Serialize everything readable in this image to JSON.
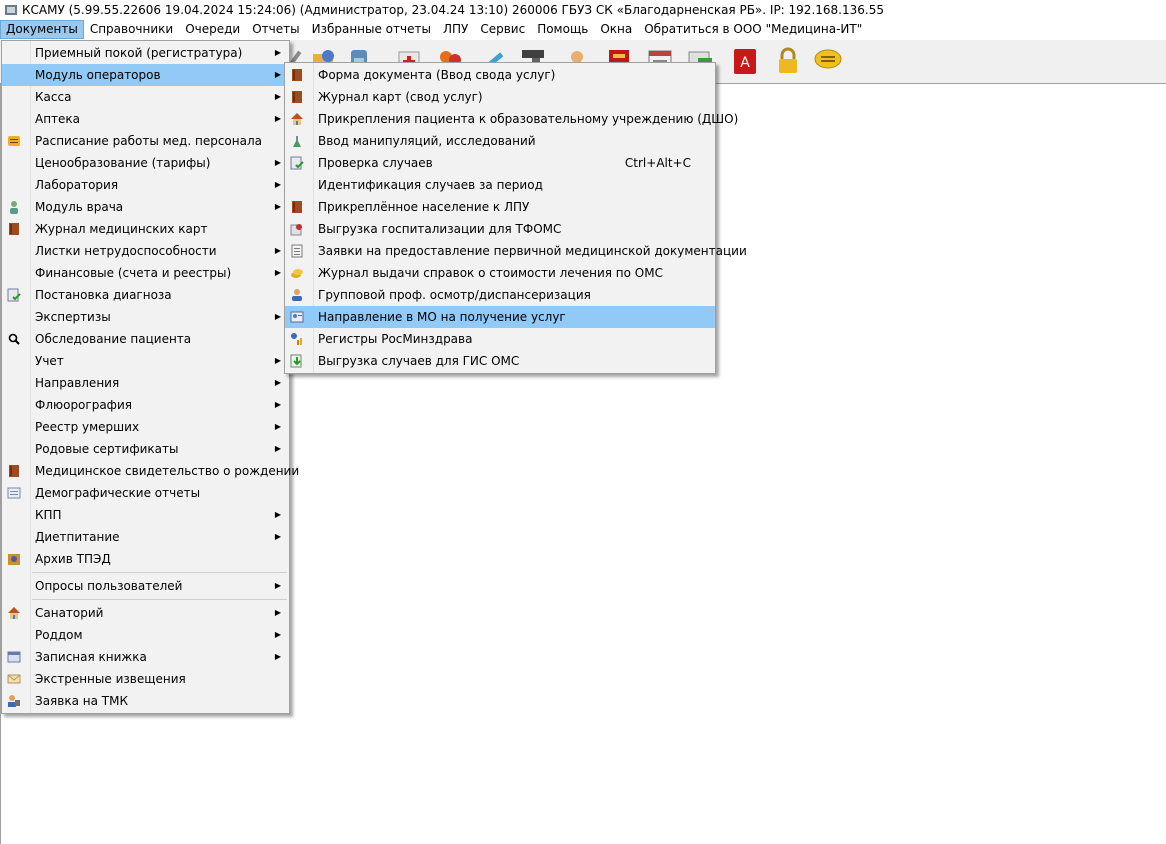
{
  "window": {
    "title": "КСАМУ (5.99.55.22606 19.04.2024 15:24:06) (Администратор, 23.04.24 13:10)  260006 ГБУЗ СК «Благодарненская РБ». IP: 192.168.136.55"
  },
  "menubar": {
    "items": [
      {
        "label": "Документы"
      },
      {
        "label": "Справочники"
      },
      {
        "label": "Очереди"
      },
      {
        "label": "Отчеты"
      },
      {
        "label": "Избранные отчеты"
      },
      {
        "label": "ЛПУ"
      },
      {
        "label": "Сервис"
      },
      {
        "label": "Помощь"
      },
      {
        "label": "Окна"
      },
      {
        "label": "Обратиться в ООО \"Медицина-ИТ\""
      }
    ]
  },
  "toolbar": {
    "icons": [
      "tool-icon",
      "patients-icon",
      "beaker-icon",
      "medkit-icon",
      "users-icon",
      "syringe-icon",
      "scanner-icon",
      "contact-icon",
      "red-book-icon",
      "report-icon",
      "money-icon",
      "pdf-icon",
      "lock-icon",
      "chat-icon"
    ]
  },
  "documents_menu": {
    "items": [
      {
        "label": "Приемный покой (регистратура)",
        "submenu": true,
        "icon": ""
      },
      {
        "label": "Модуль операторов",
        "submenu": true,
        "icon": ""
      },
      {
        "label": "Касса",
        "submenu": true,
        "icon": ""
      },
      {
        "label": "Аптека",
        "submenu": true,
        "icon": ""
      },
      {
        "label": "Расписание работы мед. персонала",
        "submenu": false,
        "icon": "schedule-icon"
      },
      {
        "label": "Ценообразование (тарифы)",
        "submenu": true,
        "icon": ""
      },
      {
        "label": "Лаборатория",
        "submenu": true,
        "icon": ""
      },
      {
        "label": "Модуль врача",
        "submenu": true,
        "icon": "doctor-icon"
      },
      {
        "label": "Журнал медицинских карт",
        "submenu": false,
        "icon": "book-icon"
      },
      {
        "label": "Листки нетрудоспособности",
        "submenu": true,
        "icon": ""
      },
      {
        "label": "Финансовые (счета и реестры)",
        "submenu": true,
        "icon": ""
      },
      {
        "label": "Постановка диагноза",
        "submenu": false,
        "icon": "check-doc-icon"
      },
      {
        "label": "Экспертизы",
        "submenu": true,
        "icon": ""
      },
      {
        "label": "Обследование пациента",
        "submenu": false,
        "icon": "search-icon"
      },
      {
        "label": "Учет",
        "submenu": true,
        "icon": ""
      },
      {
        "label": "Направления",
        "submenu": true,
        "icon": ""
      },
      {
        "label": "Флюорография",
        "submenu": true,
        "icon": ""
      },
      {
        "label": "Реестр умерших",
        "submenu": true,
        "icon": ""
      },
      {
        "label": "Родовые сертификаты",
        "submenu": true,
        "icon": ""
      },
      {
        "label": "Медицинское свидетельство о рождении",
        "submenu": false,
        "icon": "book-icon"
      },
      {
        "label": "Демографические отчеты",
        "submenu": false,
        "icon": "document-icon"
      },
      {
        "label": "КПП",
        "submenu": true,
        "icon": ""
      },
      {
        "label": "Диетпитание",
        "submenu": true,
        "icon": ""
      },
      {
        "label": "Архив ТПЭД",
        "submenu": false,
        "icon": "archive-icon"
      },
      {
        "label": "Опросы пользователей",
        "submenu": true,
        "icon": "",
        "sep_before": true
      },
      {
        "label": "Санаторий",
        "submenu": true,
        "icon": "house-icon",
        "sep_before": true
      },
      {
        "label": "Роддом",
        "submenu": true,
        "icon": ""
      },
      {
        "label": "Записная книжка",
        "submenu": true,
        "icon": "notebook-icon"
      },
      {
        "label": "Экстренные извещения",
        "submenu": false,
        "icon": "envelope-icon"
      },
      {
        "label": "Заявка на ТМК",
        "submenu": false,
        "icon": "tmk-icon"
      }
    ],
    "highlighted_index": 1
  },
  "operators_submenu": {
    "items": [
      {
        "label": "Форма документа (Ввод свода услуг)",
        "icon": "book-icon",
        "shortcut": ""
      },
      {
        "label": "Журнал карт (свод услуг)",
        "icon": "book-icon",
        "shortcut": ""
      },
      {
        "label": "Прикрепления пациента к образовательному учреждению (ДШО)",
        "icon": "house-icon",
        "shortcut": ""
      },
      {
        "label": "Ввод манипуляций, исследований",
        "icon": "flask-icon",
        "shortcut": ""
      },
      {
        "label": "Проверка случаев",
        "icon": "check-doc-icon",
        "shortcut": "Ctrl+Alt+C"
      },
      {
        "label": "Идентификация случаев за период",
        "icon": "",
        "shortcut": ""
      },
      {
        "label": "Прикреплённое население к ЛПУ",
        "icon": "book-icon",
        "shortcut": ""
      },
      {
        "label": "Выгрузка госпитализации для ТФОМС",
        "icon": "export-icon",
        "shortcut": ""
      },
      {
        "label": "Заявки на предоставление первичной медицинской документации",
        "icon": "document-icon",
        "shortcut": ""
      },
      {
        "label": "Журнал выдачи справок о стоимости лечения по ОМС",
        "icon": "coins-icon",
        "shortcut": ""
      },
      {
        "label": "Групповой проф. осмотр/диспансеризация",
        "icon": "group-icon",
        "shortcut": ""
      },
      {
        "label": "Направление в МО на получение услуг",
        "icon": "referral-icon",
        "shortcut": ""
      },
      {
        "label": "Регистры РосМинздрава",
        "icon": "chart-person-icon",
        "shortcut": ""
      },
      {
        "label": "Выгрузка случаев для ГИС ОМС",
        "icon": "download-icon",
        "shortcut": ""
      }
    ],
    "highlighted_index": 11
  }
}
